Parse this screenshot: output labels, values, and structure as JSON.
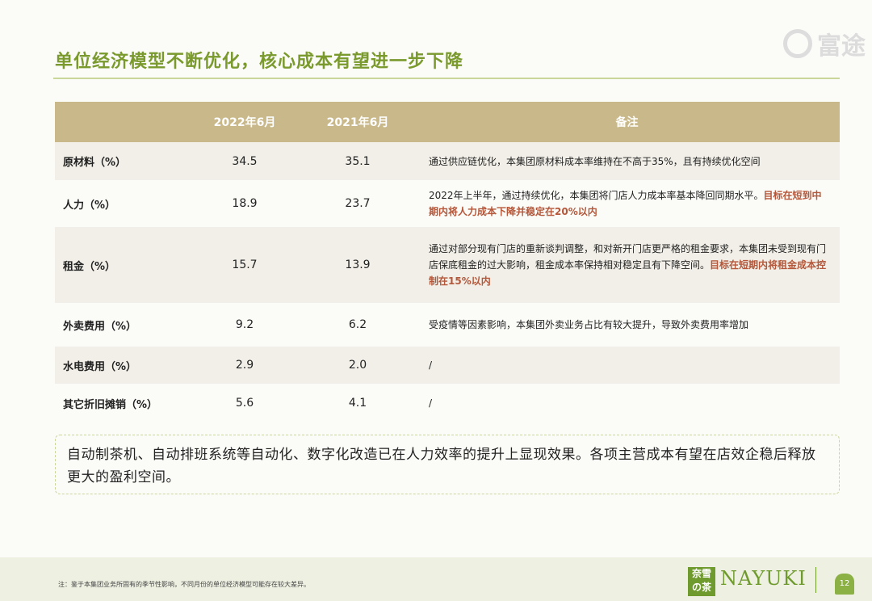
{
  "title": "单位经济模型不断优化，核心成本有望进一步下降",
  "watermark": "富途",
  "table": {
    "headers": [
      "",
      "2022年6月",
      "2021年6月",
      "备注"
    ],
    "rows": [
      {
        "label": "原材料（%）",
        "v2022": "34.5",
        "v2021": "35.1",
        "note": "通过供应链优化，本集团原材料成本率维持在不高于35%，且有持续优化空间",
        "highlight": ""
      },
      {
        "label": "人力（%）",
        "v2022": "18.9",
        "v2021": "23.7",
        "note": "2022年上半年，通过持续优化，本集团将门店人力成本率基本降回同期水平。",
        "highlight": "目标在短到中期内将人力成本下降并稳定在20%以内"
      },
      {
        "label": "租金（%）",
        "v2022": "15.7",
        "v2021": "13.9",
        "note": "通过对部分现有门店的重新谈判调整，和对新开门店更严格的租金要求，本集团未受到现有门店保底租金的过大影响，租金成本率保持相对稳定且有下降空间。",
        "highlight": "目标在短期内将租金成本控制在15%以内"
      },
      {
        "label": "外卖费用（%）",
        "v2022": "9.2",
        "v2021": "6.2",
        "note": "受疫情等因素影响，本集团外卖业务占比有较大提升，导致外卖费用率增加",
        "highlight": ""
      },
      {
        "label": "水电费用（%）",
        "v2022": "2.9",
        "v2021": "2.0",
        "note": "/",
        "highlight": ""
      },
      {
        "label": "其它折旧摊销（%）",
        "v2022": "5.6",
        "v2021": "4.1",
        "note": "/",
        "highlight": ""
      }
    ]
  },
  "summary": "自动制茶机、自动排班系统等自动化、数字化改造已在人力效率的提升上显现效果。各项主营成本有望在店效企稳后释放更大的盈利空间。",
  "footer": {
    "footnote": "注：鉴于本集团业务所固有的季节性影响，不同月份的单位经济模型可能存在较大差异。",
    "seal_text": "奈雪の茶",
    "brand": "NAYUKI",
    "page_number": "12"
  },
  "colors": {
    "accent": "#7a9a2e",
    "header_bg": "#c9b98a",
    "highlight": "#b4573a"
  }
}
